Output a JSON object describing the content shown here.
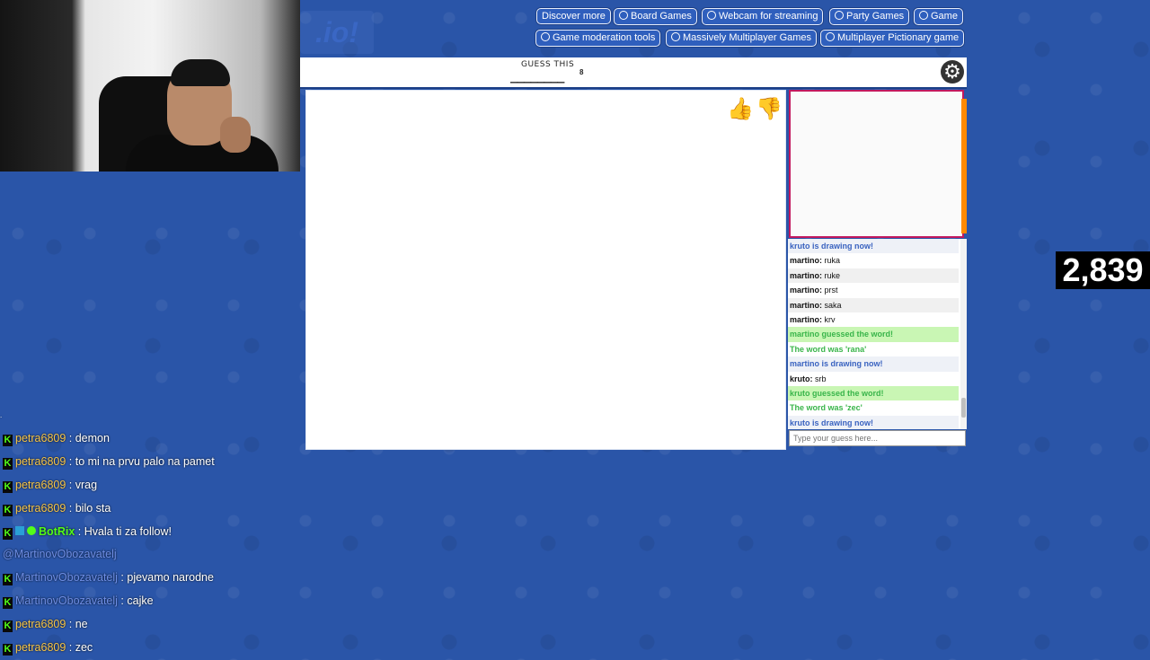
{
  "nav": {
    "discover_more": "Discover more",
    "links": [
      "Board Games",
      "Webcam for streaming",
      "Party Games",
      "Game",
      "Game moderation tools",
      "Massively Multiplayer Games",
      "Multiplayer Pictionary game"
    ]
  },
  "logo_text": ".io!",
  "game": {
    "guess_label": "GUESS THIS",
    "letter_count": "8",
    "blanks": "________",
    "thumb_up_icon": "thumbs-up-icon",
    "thumb_down_icon": "thumbs-down-icon"
  },
  "chat": {
    "messages": [
      {
        "type": "sys",
        "text": "kruto is drawing now!"
      },
      {
        "type": "user",
        "user": "martino:",
        "text": " ruka"
      },
      {
        "type": "user",
        "user": "martino:",
        "text": " ruke"
      },
      {
        "type": "user",
        "user": "martino:",
        "text": " prst"
      },
      {
        "type": "user",
        "user": "martino:",
        "text": " saka"
      },
      {
        "type": "user",
        "user": "martino:",
        "text": " krv"
      },
      {
        "type": "ok",
        "text": "martino guessed the word!"
      },
      {
        "type": "ok2",
        "text": "The word was 'rana'"
      },
      {
        "type": "sys",
        "text": "martino is drawing now!"
      },
      {
        "type": "user",
        "user": "kruto:",
        "text": " srb"
      },
      {
        "type": "ok",
        "text": "kruto guessed the word!"
      },
      {
        "type": "ok2",
        "text": "The word was 'zec'"
      },
      {
        "type": "sys",
        "text": "kruto is drawing now!"
      }
    ],
    "input_placeholder": "Type your guess here..."
  },
  "viewer_count": "2,839",
  "stream_chat": {
    "dot": ".",
    "messages": [
      {
        "user": "petra6809",
        "cls": "u-petra",
        "text": " : demon"
      },
      {
        "user": "petra6809",
        "cls": "u-petra",
        "text": " : to mi na prvu palo na pamet"
      },
      {
        "user": "petra6809",
        "cls": "u-petra",
        "text": " : vrag"
      },
      {
        "user": "petra6809",
        "cls": "u-petra",
        "text": " : bilo sta"
      },
      {
        "user": "BotRix",
        "cls": "u-bot",
        "text": " : Hvala ti za follow!",
        "bot": true
      },
      {
        "mention": "@MartinovObozavatelj"
      },
      {
        "user": "MartinovObozavatelj",
        "cls": "u-mart",
        "text": " : pjevamo narodne"
      },
      {
        "user": "MartinovObozavatelj",
        "cls": "u-mart",
        "text": " : cajke"
      },
      {
        "user": "petra6809",
        "cls": "u-petra",
        "text": " : ne"
      },
      {
        "user": "petra6809",
        "cls": "u-petra",
        "text": " : zec"
      }
    ]
  },
  "colors": {
    "background": "#2a55a8",
    "nav_button": "#2f5fbd",
    "correct_green": "#39b54a",
    "system_blue": "#3a63c0",
    "kick_green": "#53fc18"
  }
}
